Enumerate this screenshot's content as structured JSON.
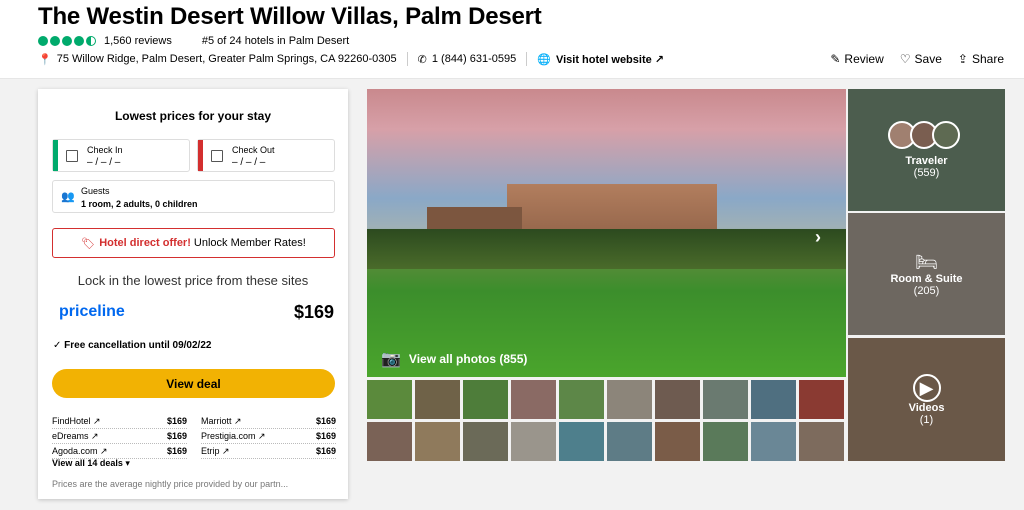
{
  "hotel": {
    "name": "The Westin Desert Willow Villas, Palm Desert",
    "reviews": "1,560 reviews",
    "rank": "#5 of 24 hotels in Palm Desert",
    "address": "75 Willow Ridge, Palm Desert, Greater Palm Springs, CA 92260-0305",
    "phone": "1 (844) 631-0595",
    "website": "Visit hotel website",
    "rating_bubbles": 4.5
  },
  "actions": {
    "review": "Review",
    "save": "Save",
    "share": "Share"
  },
  "booking": {
    "title": "Lowest prices for your stay",
    "check_in_label": "Check In",
    "check_in_value": "– / – / –",
    "check_out_label": "Check Out",
    "check_out_value": "– / – / –",
    "guests_label": "Guests",
    "guests_value": "1 room, 2 adults, 0 children",
    "offer_bold": "Hotel direct offer!",
    "offer_text": "Unlock Member Rates!",
    "lock_text": "Lock in the lowest price from these sites",
    "provider": "priceline",
    "price": "$169",
    "free_cancel": "Free cancellation until 09/02/22",
    "view_deal": "View deal",
    "deals_left": [
      {
        "name": "FindHotel",
        "price": "$169"
      },
      {
        "name": "eDreams",
        "price": "$169"
      },
      {
        "name": "Agoda.com",
        "price": "$169"
      }
    ],
    "deals_right": [
      {
        "name": "Marriott",
        "price": "$169"
      },
      {
        "name": "Prestigia.com",
        "price": "$169"
      },
      {
        "name": "Etrip",
        "price": "$169"
      }
    ],
    "view_all": "View all 14 deals",
    "note": "Prices are the average nightly price provided by our partn..."
  },
  "photos": {
    "view_all": "View all photos (855)",
    "traveler_label": "Traveler",
    "traveler_count": "(559)",
    "room_label": "Room & Suite",
    "room_count": "(205)",
    "videos_label": "Videos",
    "videos_count": "(1)"
  },
  "colors": {
    "accent_green": "#00aa6c",
    "deal_yellow": "#f2b203",
    "offer_red": "#d32f2f",
    "priceline_blue": "#0068ef"
  }
}
